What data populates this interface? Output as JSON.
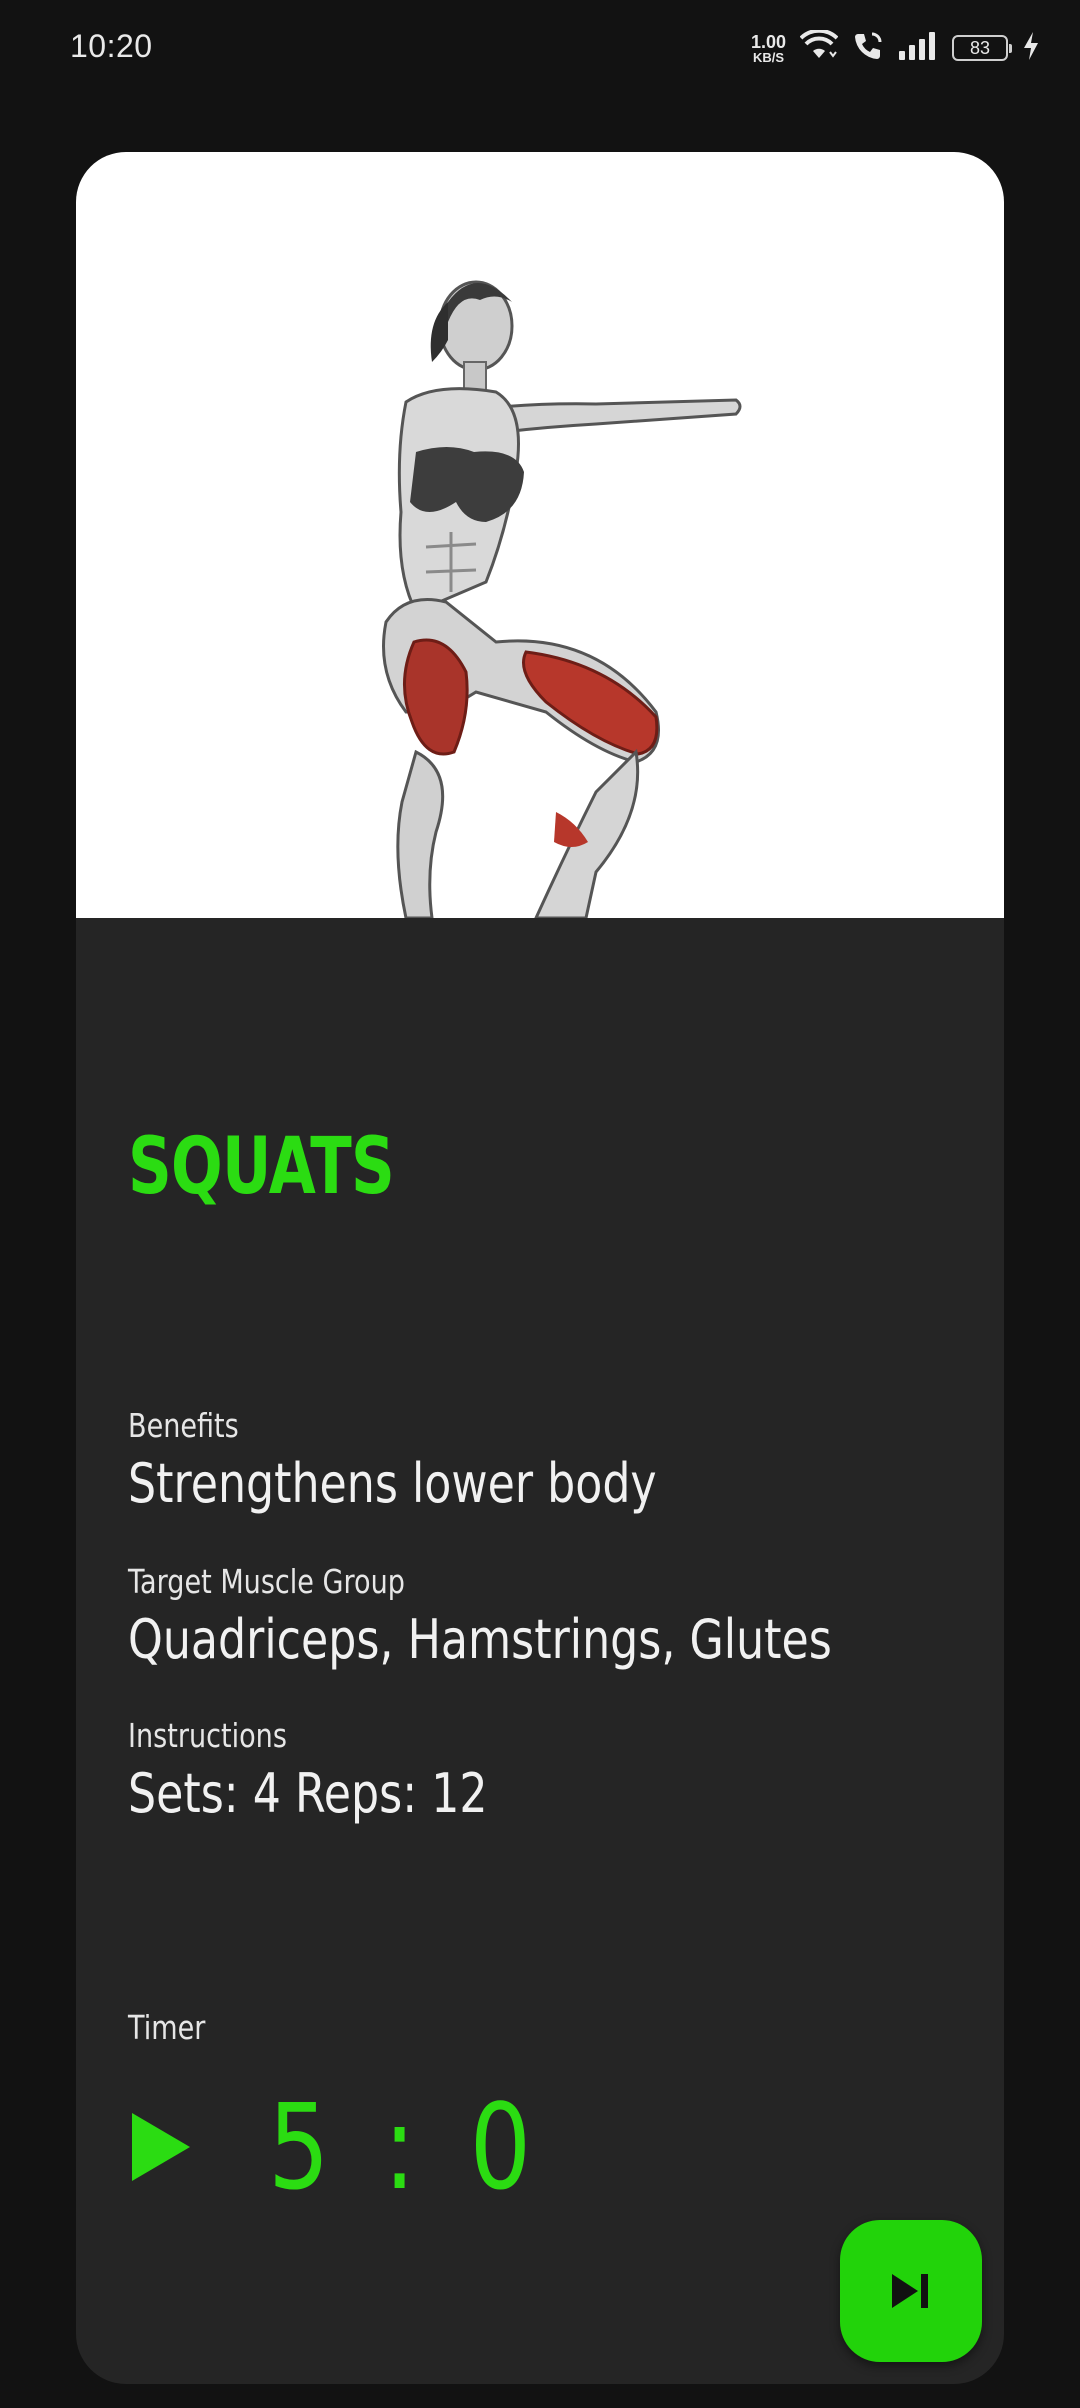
{
  "status_bar": {
    "time": "10:20",
    "net_speed_value": "1.00",
    "net_speed_unit": "KB/S",
    "battery": "83",
    "icons": [
      "wifi-icon",
      "wifi-call-icon",
      "signal-icon",
      "battery-icon",
      "charging-icon"
    ]
  },
  "exercise": {
    "image": "squat-illustration",
    "title": "SQUATS",
    "benefits_label": "Benefits",
    "benefits": "Strengthens lower body",
    "target_label": "Target Muscle Group",
    "target": "Quadriceps, Hamstrings, Glutes",
    "instructions_label": "Instructions",
    "instructions": "Sets: 4 Reps: 12"
  },
  "timer": {
    "label": "Timer",
    "value": "5 : 0",
    "play_icon": "play-icon"
  },
  "actions": {
    "skip_icon": "skip-next-icon"
  },
  "colors": {
    "background": "#121212",
    "card": "#252525",
    "accent": "#2bdc12",
    "button": "#22d30a"
  }
}
